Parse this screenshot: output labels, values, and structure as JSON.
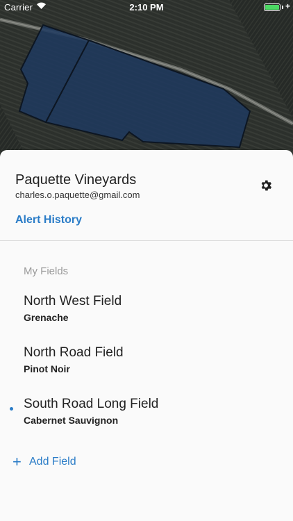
{
  "status_bar": {
    "carrier": "Carrier",
    "time": "2:10 PM",
    "charging_symbol": "+"
  },
  "account": {
    "name": "Paquette Vineyards",
    "email": "charles.o.paquette@gmail.com"
  },
  "links": {
    "alert_history": "Alert History"
  },
  "fields_section": {
    "title": "My Fields",
    "fields": [
      {
        "name": "North West Field",
        "variety": "Grenache",
        "selected": false
      },
      {
        "name": "North Road Field",
        "variety": "Pinot Noir",
        "selected": false
      },
      {
        "name": "South Road Long Field",
        "variety": "Cabernet Sauvignon",
        "selected": true
      }
    ]
  },
  "add_field": {
    "plus": "+",
    "label": "Add Field"
  },
  "colors": {
    "accent": "#2a7cc7",
    "battery": "#4cd964",
    "field_overlay": "#1e3a5f"
  },
  "icons": [
    "wifi-icon",
    "battery-icon",
    "gear-icon",
    "plus-icon"
  ]
}
